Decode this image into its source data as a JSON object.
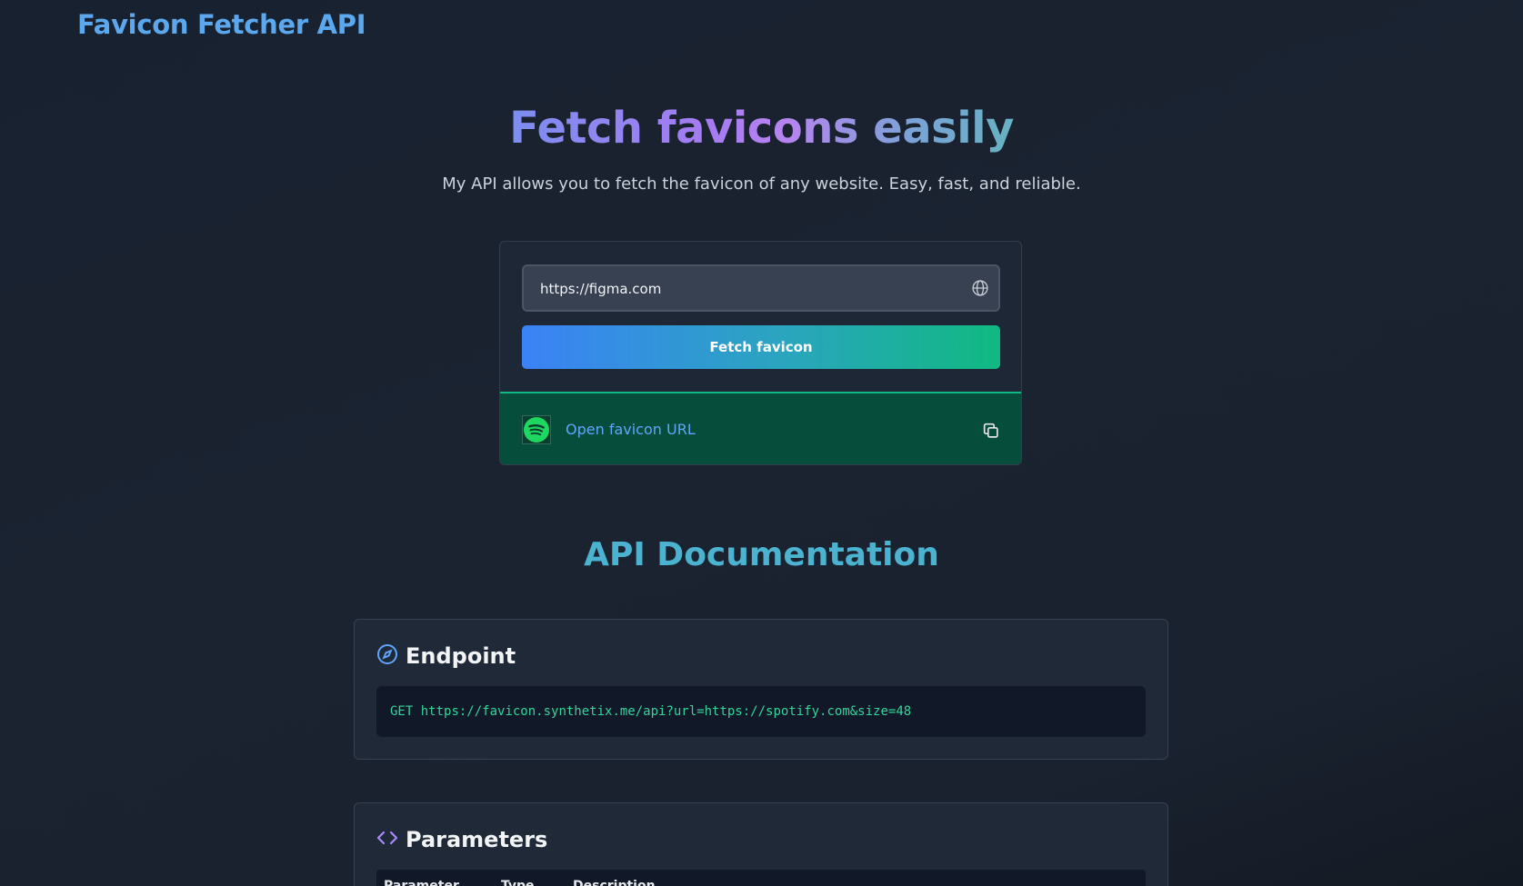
{
  "brand": "Favicon Fetcher API",
  "hero": {
    "title": "Fetch favicons easily",
    "subtitle": "My API allows you to fetch the favicon of any website. Easy, fast, and reliable."
  },
  "fetcher": {
    "url_value": "https://figma.com",
    "button_label": "Fetch favicon",
    "result_link_label": "Open favicon URL",
    "result_icon": "spotify-logo"
  },
  "docs": {
    "title": "API Documentation",
    "endpoint": {
      "heading": "Endpoint",
      "icon": "compass-icon",
      "method": "GET",
      "url": "https://favicon.synthetix.me/api?url=https://spotify.com&size=48"
    },
    "parameters": {
      "heading": "Parameters",
      "icon": "code-icon",
      "columns": [
        "Parameter",
        "Type",
        "Description"
      ]
    }
  },
  "colors": {
    "brand": "#5ca8ee",
    "success_bg": "#064e3b",
    "success_border": "#10b981",
    "code_text": "#34d399",
    "link": "#60a5fa",
    "spotify_green": "#1ed760"
  }
}
